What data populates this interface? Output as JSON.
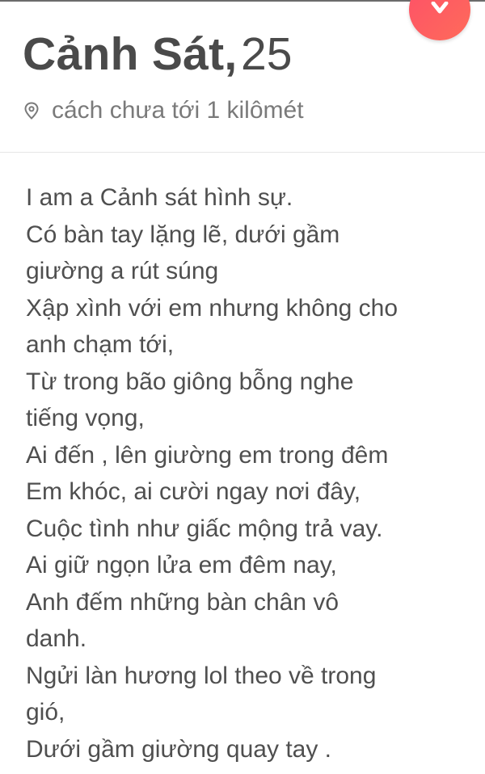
{
  "profile": {
    "name": "Cảnh Sát,",
    "age": "25",
    "distance": "cách chưa tới 1 kilômét"
  },
  "icons": {
    "fab": "chevron-down-icon",
    "location": "location-pin-icon"
  },
  "colors": {
    "accent": "#fd5068",
    "text": "#4a4a4a",
    "muted": "#7a7a7a"
  },
  "bio_lines": [
    "I am a Cảnh sát hình sự.",
    "Có bàn tay lặng lẽ, dưới gầm",
    "giường a rút súng",
    "Xập xình với em nhưng không cho",
    "anh chạm tới,",
    "Từ trong bão giông bỗng nghe",
    "tiếng vọng,",
    "Ai đến , lên giường em trong đêm",
    "Em khóc, ai cười ngay nơi đây,",
    "Cuộc tình như giấc mộng trả vay.",
    "Ai giữ ngọn lửa em đêm nay,",
    "Anh đếm những bàn chân vô",
    "danh.",
    "Ngửi làn hương lol theo về trong",
    "gió,",
    "Dưới gầm giường quay tay ."
  ]
}
